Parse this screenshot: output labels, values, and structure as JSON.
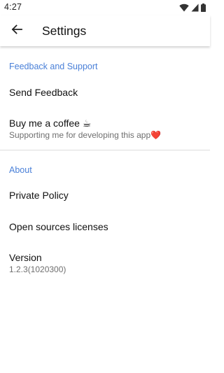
{
  "status_bar": {
    "time": "4:27",
    "icons": [
      "wifi-icon",
      "cell-signal-icon",
      "battery-icon"
    ]
  },
  "app_bar": {
    "title": "Settings",
    "back_icon": "arrow-back-icon"
  },
  "sections": {
    "feedback": {
      "header": "Feedback and Support",
      "items": [
        {
          "title": "Send Feedback"
        },
        {
          "title": "Buy me a coffee ☕",
          "summary": "Supporting me for developing this app❤️"
        }
      ]
    },
    "about": {
      "header": "About",
      "items": [
        {
          "title": "Private Policy"
        },
        {
          "title": "Open sources licenses"
        },
        {
          "title": "Version",
          "summary": "1.2.3(1020300)"
        }
      ]
    }
  },
  "colors": {
    "accent": "#4a80d8",
    "heart": "#e06a6a",
    "divider": "#dcdcdc",
    "summary_text": "#6f6f6f"
  }
}
